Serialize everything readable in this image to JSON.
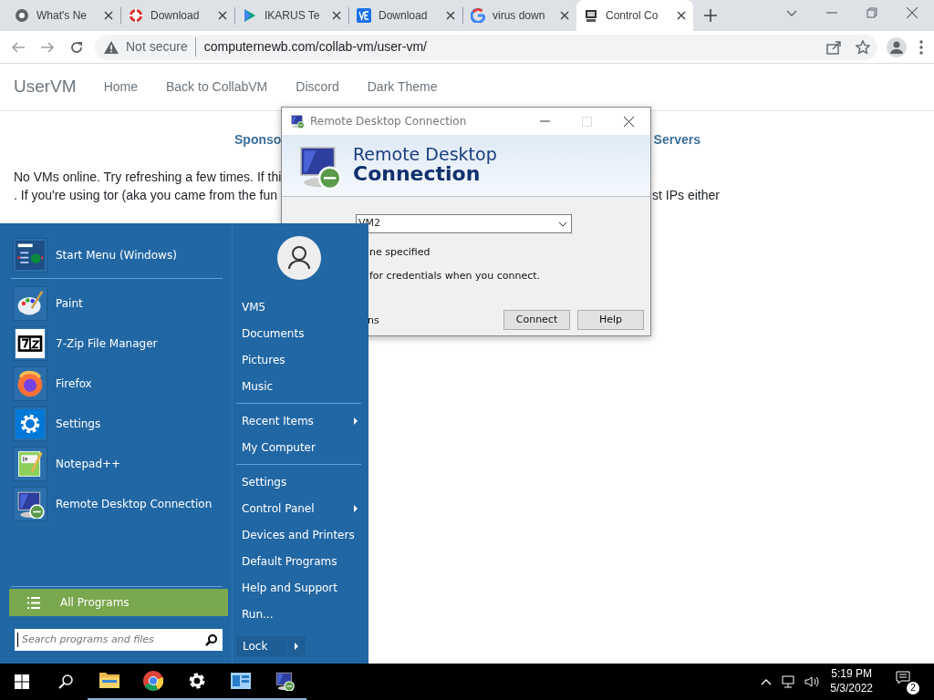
{
  "browser": {
    "tabs": [
      {
        "title": "What's Ne",
        "kind": "chrome",
        "selected": false
      },
      {
        "title": "Download",
        "kind": "target",
        "selected": false
      },
      {
        "title": "IKARUS Te",
        "kind": "play",
        "selected": false
      },
      {
        "title": "Download",
        "kind": "ve",
        "selected": false
      },
      {
        "title": "virus down",
        "kind": "google",
        "selected": false
      },
      {
        "title": "Control Co",
        "kind": "computer",
        "selected": true
      }
    ],
    "address": {
      "security": "Not secure",
      "url": "computernewb.com/collab-vm/user-vm/"
    }
  },
  "page": {
    "brand": "UserVM",
    "nav": [
      "Home",
      "Back to CollabVM",
      "Discord",
      "Dark Theme"
    ],
    "heading_left": "Sponso",
    "heading_right": "Servers",
    "lines": [
      {
        "left": "No VMs online. Try refreshing a few times. If thi"
      },
      {
        "left": ". If you're using tor (aka you came from the fun",
        "right": "st IPs either"
      }
    ]
  },
  "rdp_dialog": {
    "title": "Remote Desktop Connection",
    "banner_line1": "Remote Desktop",
    "banner_line2": "Connection",
    "computer": "VM2",
    "user_text": "ne specified",
    "credentials_text": "for credentials when you connect.",
    "options_text": "ns",
    "buttons": [
      "Connect",
      "Help"
    ]
  },
  "start_menu": {
    "pinned": [
      {
        "label": "Start Menu (Windows)",
        "kind": "start"
      },
      {
        "label": "Paint",
        "kind": "paint"
      },
      {
        "label": "7-Zip File Manager",
        "kind": "zip"
      },
      {
        "label": "Firefox",
        "kind": "firefox"
      },
      {
        "label": "Settings",
        "kind": "settings"
      },
      {
        "label": "Notepad++",
        "kind": "notepad"
      },
      {
        "label": "Remote Desktop Connection",
        "kind": "rdp"
      }
    ],
    "all_programs": "All Programs",
    "search": {
      "placeholder": "Search programs and files"
    },
    "sections": [
      {
        "items": [
          {
            "label": "VM5",
            "submenu": false
          },
          {
            "label": "Documents",
            "submenu": false
          },
          {
            "label": "Pictures",
            "submenu": false
          },
          {
            "label": "Music",
            "submenu": false
          }
        ]
      },
      {
        "items": [
          {
            "label": "Recent Items",
            "submenu": true
          },
          {
            "label": "My Computer",
            "submenu": false
          }
        ]
      },
      {
        "items": [
          {
            "label": "Settings",
            "submenu": false
          },
          {
            "label": "Control Panel",
            "submenu": true
          },
          {
            "label": "Devices and Printers",
            "submenu": false
          },
          {
            "label": "Default Programs",
            "submenu": false
          },
          {
            "label": "Help and Support",
            "submenu": false
          },
          {
            "label": "Run...",
            "submenu": false
          }
        ]
      }
    ],
    "lock": "Lock"
  },
  "taskbar": {
    "apps": [
      {
        "kind": "windows",
        "running": false
      },
      {
        "kind": "search",
        "running": false
      },
      {
        "kind": "folder",
        "running": true
      },
      {
        "kind": "chrome",
        "running": true
      },
      {
        "kind": "settings",
        "running": true
      },
      {
        "kind": "panel",
        "running": true
      },
      {
        "kind": "rdp",
        "running": true
      }
    ],
    "time": "5:19 PM",
    "date": "5/3/2022",
    "notifications": "2"
  }
}
